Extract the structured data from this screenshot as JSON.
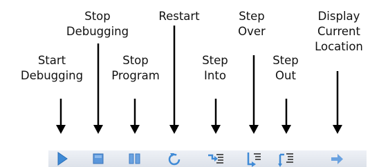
{
  "toolbar": {
    "start_debugging": "Start\nDebugging",
    "stop_debugging": "Stop\nDebugging",
    "stop_program": "Stop\nProgram",
    "restart": "Restart",
    "step_into": "Step\nInto",
    "step_over": "Step\nOver",
    "step_out": "Step\nOut",
    "display_current_location": "Display\nCurrent\nLocation"
  },
  "icons": [
    "play-icon",
    "stop-icon",
    "pause-icon",
    "restart-icon",
    "step-into-icon",
    "step-over-icon",
    "step-out-icon",
    "arrow-right-icon"
  ],
  "colors": {
    "icon_blue": "#4a8fd8",
    "toolbar_bg": "#e4e8ef"
  }
}
